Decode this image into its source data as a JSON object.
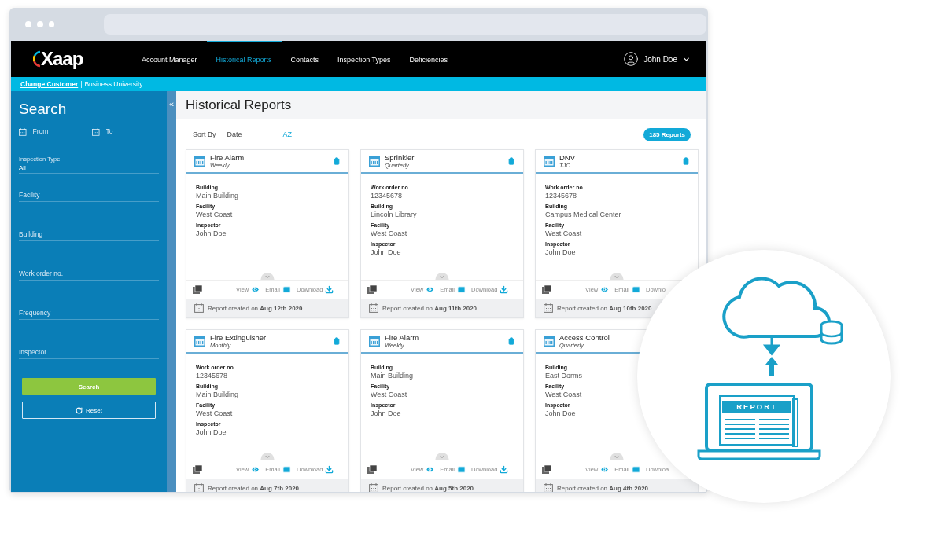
{
  "logo": {
    "text": "Xaap"
  },
  "nav": [
    {
      "label": "Account Manager",
      "selected": false
    },
    {
      "label": "Historical Reports",
      "selected": true
    },
    {
      "label": "Contacts",
      "selected": false
    },
    {
      "label": "Inspection Types",
      "selected": false
    },
    {
      "label": "Deficiencies",
      "selected": false
    }
  ],
  "user": {
    "name": "John Doe"
  },
  "customer_bar": {
    "link": "Change Customer",
    "separator": "|",
    "customer": "Business University"
  },
  "sidebar": {
    "title": "Search",
    "collapse": "«",
    "date_fields": [
      {
        "placeholder": "From"
      },
      {
        "placeholder": "To"
      }
    ],
    "inspection_type": {
      "label": "Inspection Type",
      "value": "All"
    },
    "fields": [
      {
        "placeholder": "Facility"
      },
      {
        "placeholder": "Building"
      },
      {
        "placeholder": "Work order no."
      },
      {
        "placeholder": "Frequency"
      },
      {
        "placeholder": "Inspector"
      }
    ],
    "buttons": [
      {
        "label": "Search",
        "kind": "primary"
      },
      {
        "label": "Reset",
        "kind": "reset"
      }
    ]
  },
  "page": {
    "title": "Historical Reports",
    "sort_label": "Sort By",
    "sort_options": [
      {
        "label": "Date",
        "selected": false
      },
      {
        "label": "AZ",
        "selected": true
      }
    ],
    "count_badge": "185 Reports"
  },
  "cards": [
    {
      "title": "Fire Alarm",
      "frequency": "Weekly",
      "kind": "full",
      "fields": [
        {
          "label": "Building",
          "value": "Main Building"
        },
        {
          "label": "Facility",
          "value": "West Coast"
        },
        {
          "label": "Inspector",
          "value": "John Doe"
        }
      ],
      "actions": [
        {
          "label": "View",
          "kind": "view"
        },
        {
          "label": "Email",
          "kind": "email"
        },
        {
          "label": "Download",
          "kind": "download"
        }
      ],
      "created": "Report created on **Aug 12th 2020**"
    },
    {
      "title": "Sprinkler",
      "frequency": "Quarterly",
      "kind": "full",
      "fields": [
        {
          "label": "Work order no.",
          "value": "12345678"
        },
        {
          "label": "Building",
          "value": "Lincoln Library"
        },
        {
          "label": "Facility",
          "value": "West Coast"
        },
        {
          "label": "Inspector",
          "value": "John Doe"
        }
      ],
      "actions": [
        {
          "label": "View",
          "kind": "view"
        },
        {
          "label": "Email",
          "kind": "email"
        },
        {
          "label": "Download",
          "kind": "download"
        }
      ],
      "created": "Report created on **Aug 11th 2020**"
    },
    {
      "title": "DNV",
      "frequency": "TJC",
      "kind": "full",
      "fields": [
        {
          "label": "Work order no.",
          "value": "12345678"
        },
        {
          "label": "Building",
          "value": "Campus Medical Center"
        },
        {
          "label": "Facility",
          "value": "West Coast"
        },
        {
          "label": "Inspector",
          "value": "John Doe"
        }
      ],
      "actions": [
        {
          "label": "View",
          "kind": "view"
        },
        {
          "label": "Email",
          "kind": "email"
        },
        {
          "label": "Downlo",
          "kind": "text"
        }
      ],
      "created": "Report created on **Aug 10th 2020**"
    },
    {
      "title": "Fire Extinguisher",
      "frequency": "Monthly",
      "kind": "full",
      "fields": [
        {
          "label": "Work order no.",
          "value": "12345678"
        },
        {
          "label": "Building",
          "value": "Main Building"
        },
        {
          "label": "Facility",
          "value": "West Coast"
        },
        {
          "label": "Inspector",
          "value": "John Doe"
        }
      ],
      "actions": [
        {
          "label": "View",
          "kind": "view"
        },
        {
          "label": "Email",
          "kind": "email"
        },
        {
          "label": "Download",
          "kind": "download"
        }
      ],
      "created": "Report created on **Aug 7th 2020**"
    },
    {
      "title": "Fire Alarm",
      "frequency": "Weekly",
      "kind": "full",
      "fields": [
        {
          "label": "Building",
          "value": "Main Building"
        },
        {
          "label": "Facility",
          "value": "West Coast"
        },
        {
          "label": "Inspector",
          "value": "John Doe"
        }
      ],
      "actions": [
        {
          "label": "View",
          "kind": "view"
        },
        {
          "label": "Email",
          "kind": "email"
        },
        {
          "label": "Download",
          "kind": "download"
        }
      ],
      "created": "Report created on **Aug 5th 2020**"
    },
    {
      "title": "Access Control",
      "frequency": "Quarterly",
      "kind": "clipped",
      "fields": [
        {
          "label": "Building",
          "value": "East Dorms"
        },
        {
          "label": "Facility",
          "value": "West Coast"
        },
        {
          "label": "Inspector",
          "value": "John Doe"
        }
      ],
      "actions": [
        {
          "label": "View",
          "kind": "view"
        },
        {
          "label": "Email",
          "kind": "email"
        },
        {
          "label": "Downloa",
          "kind": "text"
        }
      ],
      "created": "Report created on **Aug 4th 2020**"
    }
  ],
  "illustration": {
    "label": "REPORT"
  }
}
